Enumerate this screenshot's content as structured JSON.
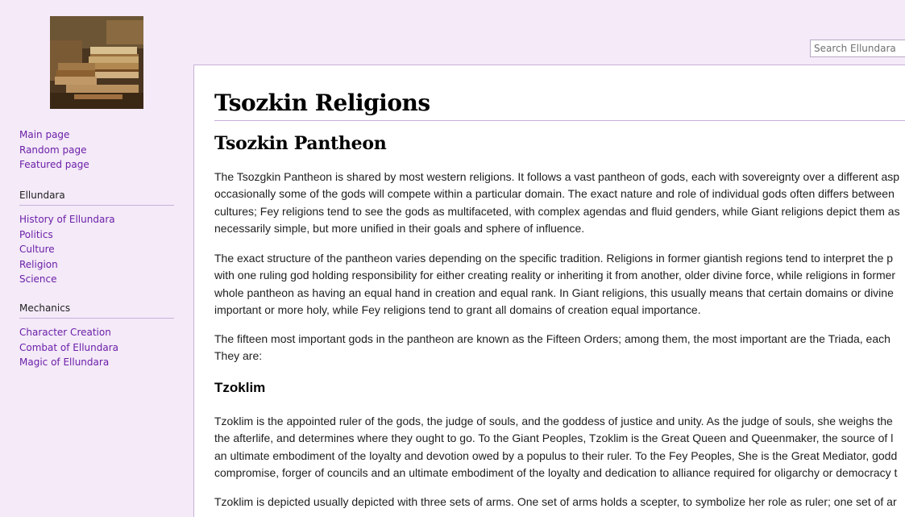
{
  "search": {
    "placeholder": "Search Ellundara"
  },
  "sidebar": {
    "logo_alt": "Stack of old books",
    "main_links": [
      "Main page",
      "Random page",
      "Featured page"
    ],
    "sections": [
      {
        "heading": "Ellundara",
        "links": [
          "History of Ellundara",
          "Politics",
          "Culture",
          "Religion",
          "Science"
        ]
      },
      {
        "heading": "Mechanics",
        "links": [
          "Character Creation",
          "Combat of Ellundara",
          "Magic of Ellundara"
        ]
      }
    ]
  },
  "article": {
    "title": "Tsozkin Religions",
    "section_title": "Tsozkin Pantheon",
    "paragraphs": [
      [
        "The Tsozgkin Pantheon is shared by most western religions. It follows a vast pantheon of gods, each with sovereignty over a different asp",
        "occasionally some of the gods will compete within a particular domain. The exact nature and role of individual gods often differs between",
        "cultures; Fey religions tend to see the gods as multifaceted, with complex agendas and fluid genders, while Giant religions depict them as",
        "necessarily simple, but more unified in their goals and sphere of influence."
      ],
      [
        "The exact structure of the pantheon varies depending on the specific tradition. Religions in former giantish regions tend to interpret the p",
        "with one ruling god holding responsibility for either creating reality or inheriting it from another, older divine force, while religions in former",
        "whole pantheon as having an equal hand in creation and equal rank. In Giant religions, this usually means that certain domains or divine",
        "important or more holy, while Fey religions tend to grant all domains of creation equal importance."
      ],
      [
        "The fifteen most important gods in the pantheon are known as the Fifteen Orders; among them, the most important are the Triada, each",
        "They are:"
      ]
    ],
    "subsection_title": "Tzoklim",
    "subsection_paragraphs": [
      [
        "Tzoklim is the appointed ruler of the gods, the judge of souls, and the goddess of justice and unity. As the judge of souls, she weighs the",
        "the afterlife, and determines where they ought to go. To the Giant Peoples, Tzoklim is the Great Queen and Queenmaker, the source of l",
        "an ultimate embodiment of the loyalty and devotion owed by a populus to their ruler. To the Fey Peoples, She is the Great Mediator, godd",
        "compromise, forger of councils and an ultimate embodiment of the loyalty and dedication to alliance required for oligarchy or democracy t"
      ],
      [
        "Tzoklim is depicted usually depicted with three sets of arms. One set of arms holds a scepter, to symbolize her role as ruler; one set of ar"
      ]
    ]
  }
}
